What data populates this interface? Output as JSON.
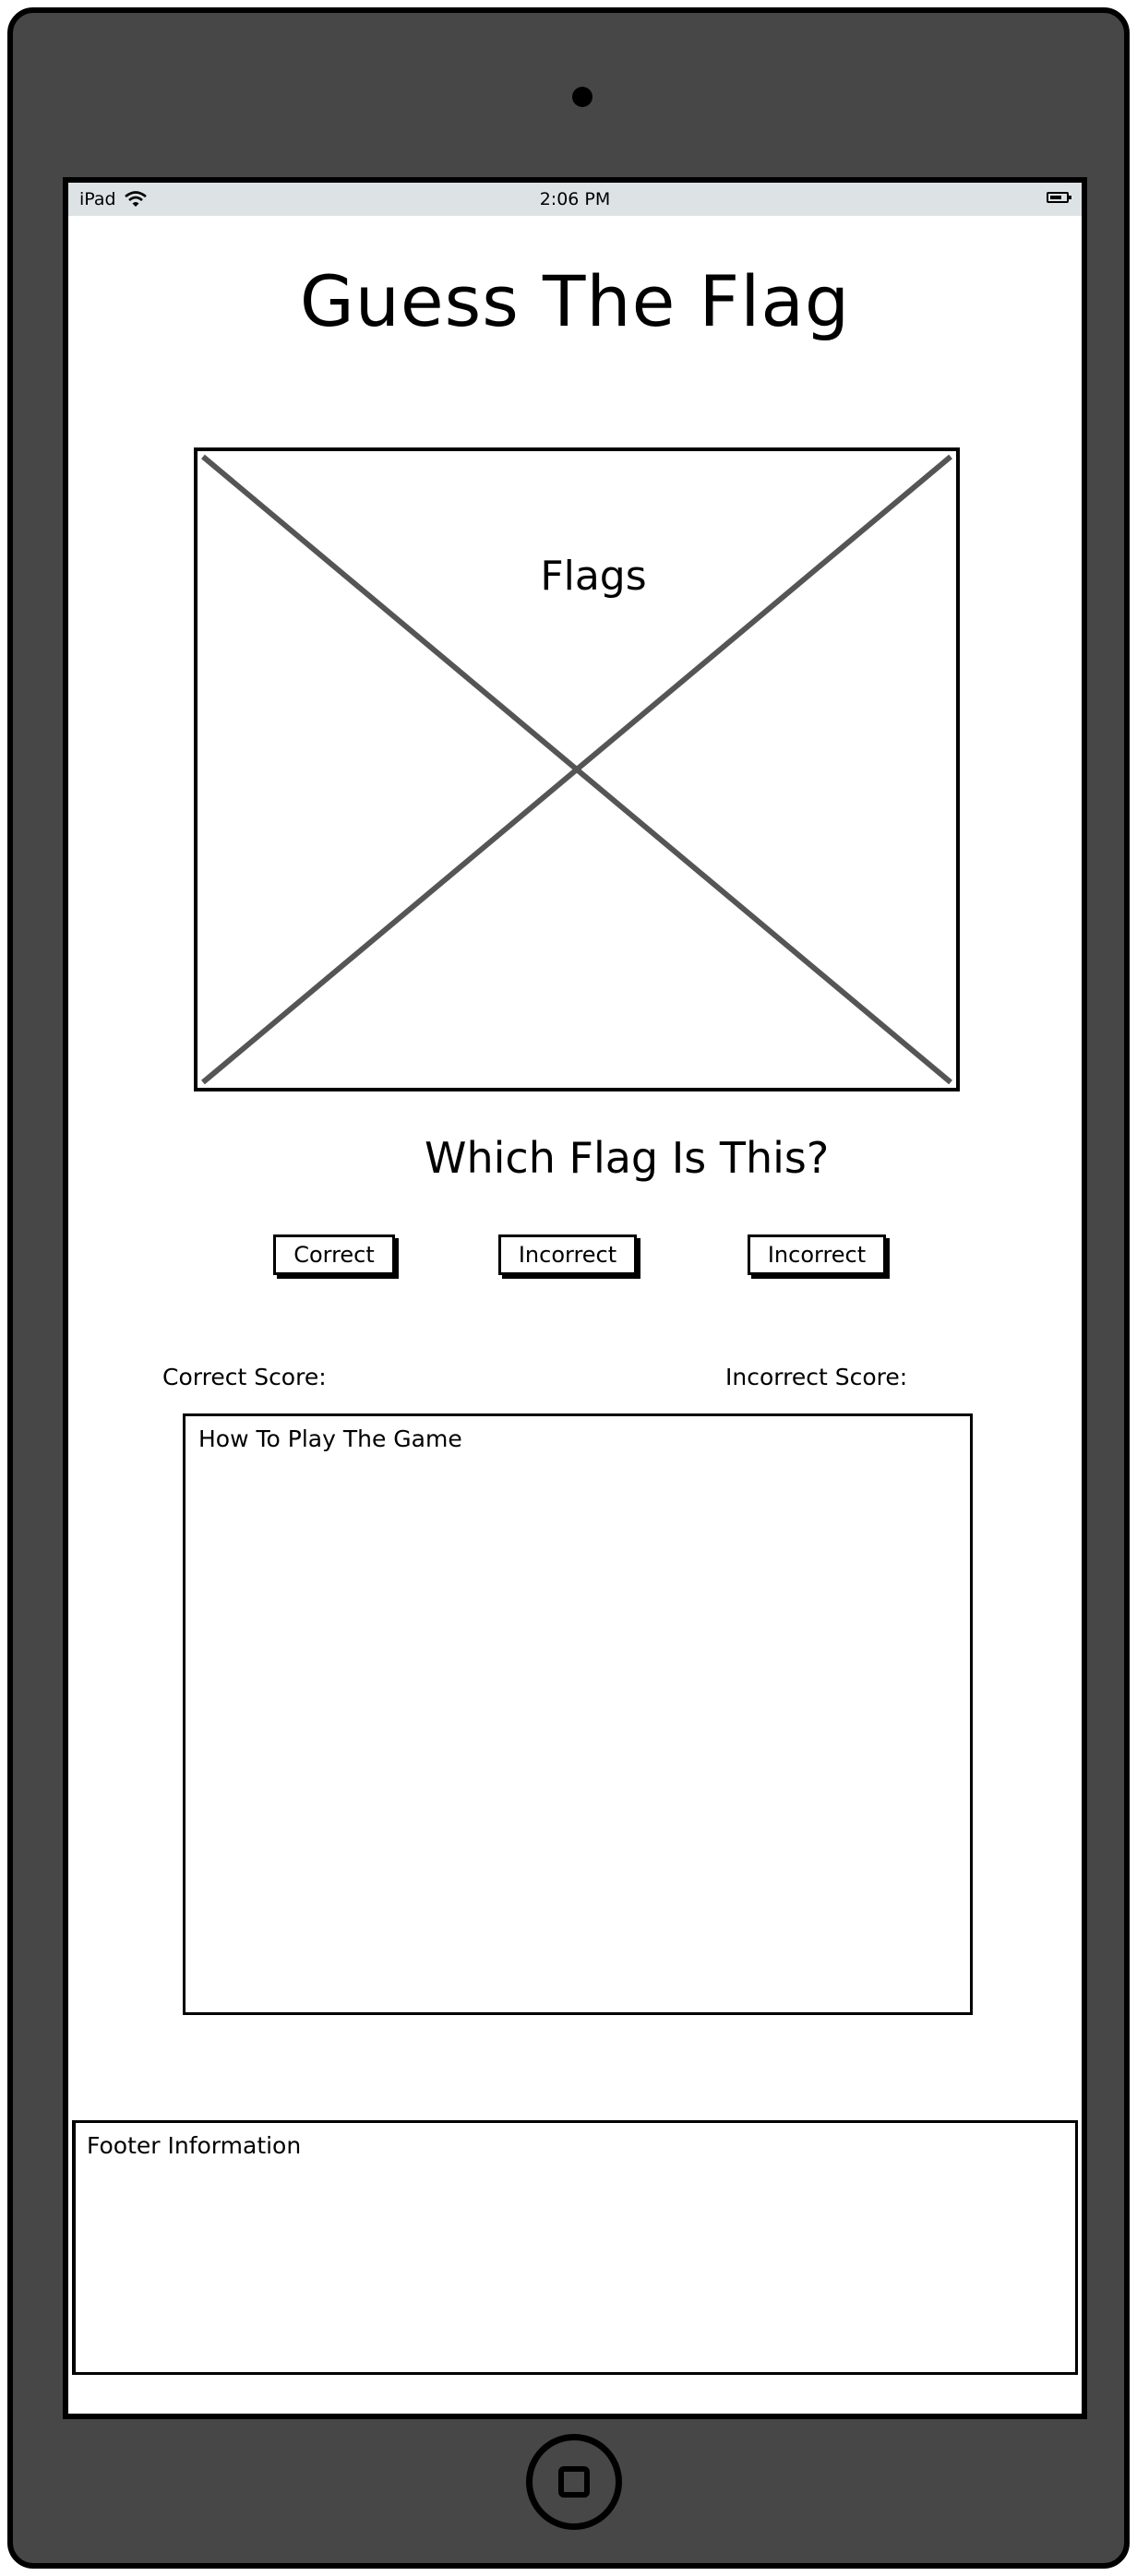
{
  "status_bar": {
    "device": "iPad",
    "time": "2:06 PM",
    "icons": [
      "wifi-icon",
      "battery-icon"
    ]
  },
  "header": {
    "title": "Guess The Flag"
  },
  "flag_area": {
    "label": "Flags"
  },
  "question": {
    "text": "Which Flag Is This?"
  },
  "answers": [
    {
      "label": "Correct"
    },
    {
      "label": "Incorrect"
    },
    {
      "label": "Incorrect"
    }
  ],
  "scores": {
    "correct_label": "Correct Score:",
    "incorrect_label": "Incorrect Score:"
  },
  "how_to_play": {
    "title": "How To Play The Game"
  },
  "footer": {
    "title": "Footer Information"
  },
  "colors": {
    "device_body": "#474747",
    "status_bar": "#dde3e5",
    "screen": "#ffffff",
    "stroke": "#000000",
    "placeholder_cross": "#555555"
  }
}
